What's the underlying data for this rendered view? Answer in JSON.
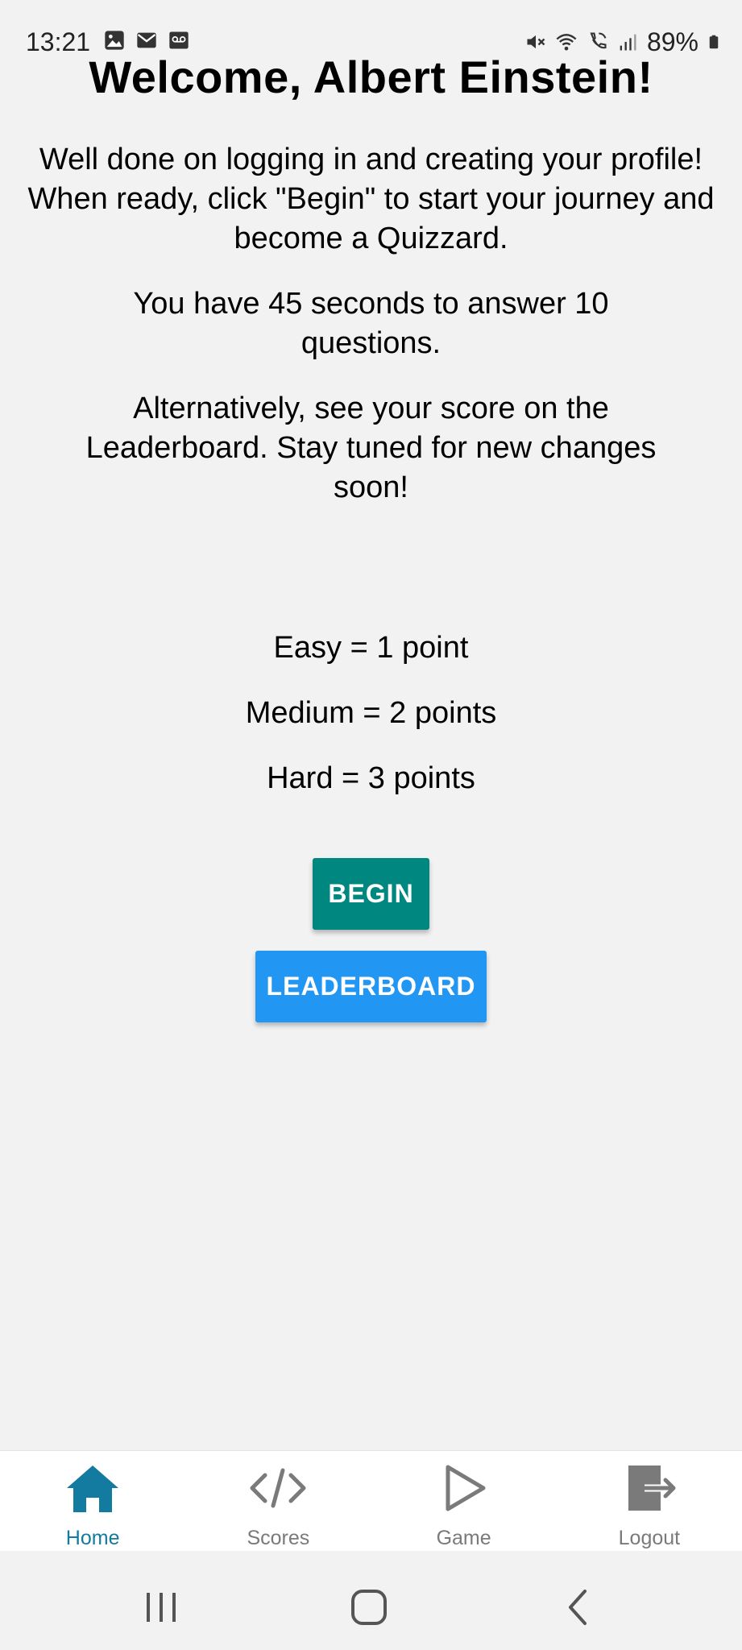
{
  "status_bar": {
    "time": "13:21",
    "battery": "89%",
    "left_icons": [
      "image-icon",
      "mail-icon",
      "voicemail-icon"
    ],
    "right_icons": [
      "mute-icon",
      "wifi-icon",
      "wifi-call-icon",
      "signal-icon",
      "battery-icon"
    ]
  },
  "main": {
    "title": "Welcome, Albert Einstein!",
    "paragraph1": "Well done on logging in and creating your profile! When ready, click \"Begin\" to start your journey and become a Quizzard.",
    "paragraph2": "You have 45 seconds to answer 10 questions.",
    "paragraph3": "Alternatively, see your score on the Leaderboard. Stay tuned for new changes soon!",
    "points": [
      "Easy = 1 point",
      "Medium = 2 points",
      "Hard = 3 points"
    ],
    "begin_label": "BEGIN",
    "leaderboard_label": "LEADERBOARD"
  },
  "bottom_nav": {
    "items": [
      {
        "label": "Home",
        "icon": "home-icon",
        "active": true
      },
      {
        "label": "Scores",
        "icon": "code-icon",
        "active": false
      },
      {
        "label": "Game",
        "icon": "play-icon",
        "active": false
      },
      {
        "label": "Logout",
        "icon": "logout-icon",
        "active": false
      }
    ]
  },
  "system_nav": {
    "buttons": [
      "recent-apps-icon",
      "home-button-icon",
      "back-icon"
    ]
  },
  "colors": {
    "background": "#f2f2f2",
    "begin_button": "#00877f",
    "leaderboard_button": "#2196f3",
    "nav_active": "#137aa0",
    "nav_inactive": "#7a7a7a"
  }
}
